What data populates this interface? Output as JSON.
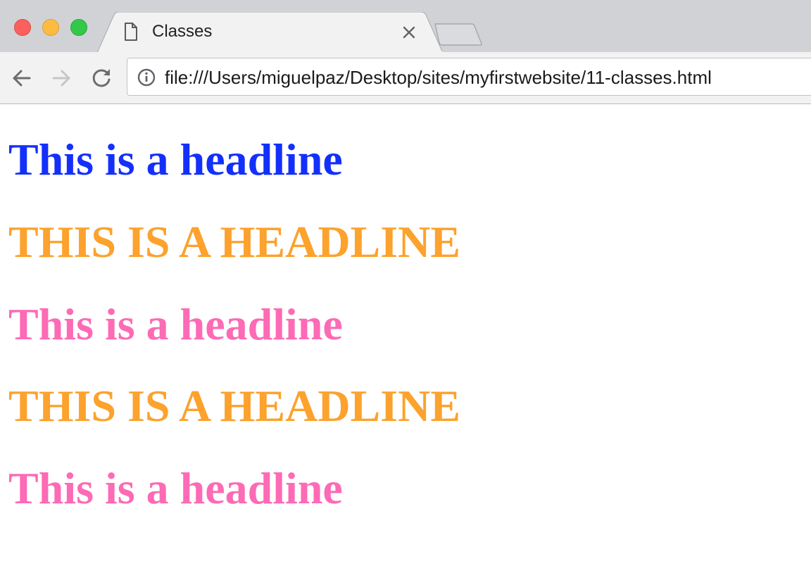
{
  "window": {
    "controls": [
      "close",
      "minimize",
      "maximize"
    ]
  },
  "tab": {
    "title": "Classes",
    "icon": "page-icon"
  },
  "toolbar": {
    "url": "file:///Users/miguelpaz/Desktop/sites/myfirstwebsite/11-classes.html",
    "security_icon": "info-icon"
  },
  "content": {
    "headlines": [
      {
        "text": "This is a headline",
        "color": "#1330fb"
      },
      {
        "text": "This is a headline",
        "color": "#fca22d"
      },
      {
        "text": "This is a headline",
        "color": "#fd6ab5"
      },
      {
        "text": "This is a headline",
        "color": "#fca22d"
      },
      {
        "text": "This is a headline",
        "color": "#fd6ab5"
      }
    ]
  },
  "colors": {
    "tabstrip_bg": "#d1d2d6",
    "toolbar_bg": "#f2f2f2",
    "blue": "#1330fb",
    "orange": "#fca22d",
    "pink": "#fd6ab5"
  }
}
